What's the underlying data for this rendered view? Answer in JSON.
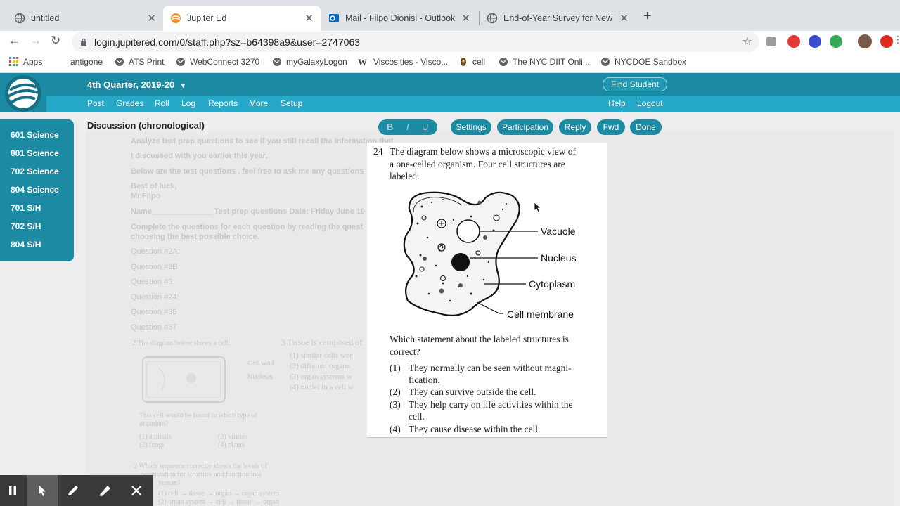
{
  "browser": {
    "tabs": [
      {
        "title": "untitled",
        "favicon": "globe-icon",
        "active": false
      },
      {
        "title": "Jupiter Ed",
        "favicon": "jupiter-logo-icon",
        "active": true
      },
      {
        "title": "Mail - Filpo Dionisi - Outlook",
        "favicon": "outlook-icon",
        "active": false
      },
      {
        "title": "End-of-Year Survey for New Te",
        "favicon": "globe-icon",
        "active": false
      }
    ],
    "url": "login.jupitered.com/0/staff.php?sz=b64398a9&user=2747063",
    "bookmarks": [
      {
        "label": "Apps",
        "icon": "apps-grid-icon"
      },
      {
        "label": "antigone",
        "icon": "none"
      },
      {
        "label": "ATS Print",
        "icon": "globe-icon"
      },
      {
        "label": "WebConnect 3270",
        "icon": "globe-icon"
      },
      {
        "label": "myGalaxyLogon",
        "icon": "globe-icon"
      },
      {
        "label": "Viscosities - Visco...",
        "icon": "w-icon"
      },
      {
        "label": "cell",
        "icon": "cell-icon"
      },
      {
        "label": "The NYC DIIT Onli...",
        "icon": "globe-icon"
      },
      {
        "label": "NYCDOE Sandbox",
        "icon": "globe-icon"
      }
    ]
  },
  "header": {
    "quarter": "4th Quarter, 2019-20",
    "find_student": "Find Student",
    "nav": [
      "Post",
      "Grades",
      "Roll",
      "Log",
      "Reports",
      "More",
      "Setup"
    ],
    "help": "Help",
    "logout": "Logout"
  },
  "sidebar": {
    "items": [
      "601 Science",
      "801 Science",
      "702 Science",
      "804 Science",
      "701 S/H",
      "702 S/H",
      "804 S/H"
    ]
  },
  "page": {
    "title": "Discussion (chronological)",
    "format": {
      "bold": "B",
      "italic": "I",
      "underline": "U"
    },
    "actions": [
      "Settings",
      "Participation",
      "Reply",
      "Fwd",
      "Done"
    ]
  },
  "background_text": {
    "l1": "Analyze test prep questions to see if you still recall the information that",
    "l2": "I discussed with you earlier this year.",
    "l3": "Below are the test questions , feel free to ask me any questions",
    "l4": "Best of luck,",
    "l5": "Mr.Filpo",
    "l6": "Name______________ Test prep questions Date: Friday June 19",
    "l7": "Complete the questions for each question by reading the quest",
    "l8": "choosing the best possible choice.",
    "q": [
      "Question #2A:",
      "Question #2B:",
      "Question #3:",
      "Question #24:",
      "Question #36",
      "Question #37"
    ],
    "s1": "2  The diagram below shows a cell.",
    "s2": "Cell wall",
    "s3": "Nucleus",
    "s4": "This cell would be found in which type of",
    "s5": "organism?",
    "s6": "(1)  animals",
    "s7": "(3)  viruses",
    "s8": "(2)  fungi",
    "s9": "(4)  plants",
    "t1": "3  Tissue is composed of",
    "t2": "(1)  similar cells wor",
    "t3": "(2)  different organs",
    "t4": "(3)  organ systems w",
    "t5": "(4)  nuclei in a cell w",
    "u1": "2  Which sequence correctly shows the levels of",
    "u2": "organization for structure and function in a",
    "u3": "human?",
    "u4": "(1)  cell → tissue → organ → organ system",
    "u5": "(2)  organ system → cell → tissue → organ"
  },
  "question": {
    "number": "24",
    "stem_line1": "The diagram below shows a microscopic view of",
    "stem_line2": "a one-celled organism. Four cell structures are",
    "stem_line3": "labeled.",
    "labels": {
      "vacuole": "Vacuole",
      "nucleus": "Nucleus",
      "cytoplasm": "Cytoplasm",
      "membrane": "Cell membrane"
    },
    "prompt_line1": "Which statement about the labeled structures is",
    "prompt_line2": "correct?",
    "choices": [
      {
        "num": "(1)",
        "text": "They normally can be seen without magni-",
        "cont": "fication."
      },
      {
        "num": "(2)",
        "text": "They can survive outside the cell.",
        "cont": ""
      },
      {
        "num": "(3)",
        "text": "They help carry on life activities within the",
        "cont": "cell."
      },
      {
        "num": "(4)",
        "text": "They cause disease within the cell.",
        "cont": ""
      }
    ]
  },
  "colors": {
    "jupiter_dark": "#1c8aa3",
    "jupiter_light": "#26a8c9"
  }
}
